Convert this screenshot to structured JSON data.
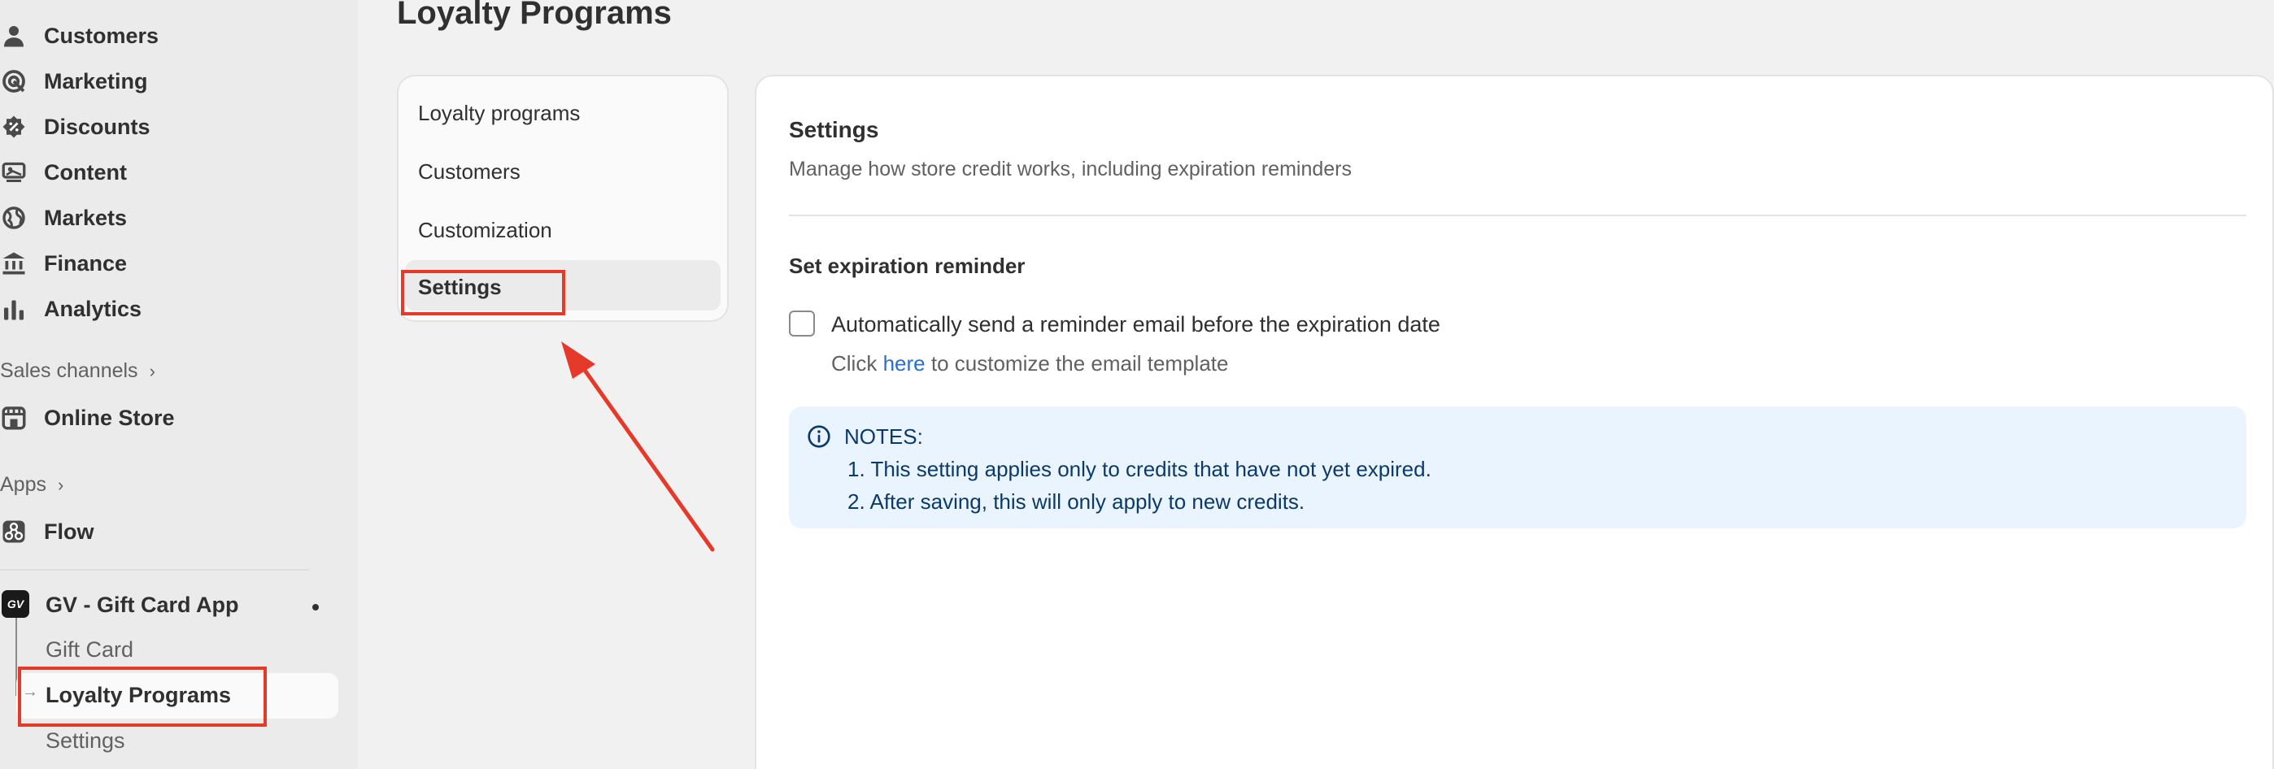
{
  "sidebar": {
    "items": [
      {
        "label": "Customers",
        "icon": "person-icon"
      },
      {
        "label": "Marketing",
        "icon": "target-icon"
      },
      {
        "label": "Discounts",
        "icon": "discount-icon"
      },
      {
        "label": "Content",
        "icon": "content-icon"
      },
      {
        "label": "Markets",
        "icon": "globe-icon"
      },
      {
        "label": "Finance",
        "icon": "bank-icon"
      },
      {
        "label": "Analytics",
        "icon": "bar-chart-icon"
      }
    ],
    "sales_channels_label": "Sales channels",
    "online_store_label": "Online Store",
    "apps_label": "Apps",
    "flow_label": "Flow",
    "app_name": "GV - Gift Card App",
    "app_badge": "GV",
    "app_sub": {
      "gift_card": "Gift Card",
      "loyalty_programs": "Loyalty Programs",
      "settings": "Settings"
    }
  },
  "page": {
    "title": "Loyalty Programs"
  },
  "tabs": {
    "loyalty_programs": "Loyalty programs",
    "customers": "Customers",
    "customization": "Customization",
    "settings": "Settings"
  },
  "settings": {
    "title": "Settings",
    "subtitle": "Manage how store credit works, including expiration reminders",
    "reminder_title": "Set expiration reminder",
    "checkbox_label": "Automatically send a reminder email before the expiration date",
    "checkbox_checked": false,
    "hint_prefix": "Click",
    "hint_link": "here",
    "hint_suffix": "to customize the email template",
    "notes_head": "NOTES:",
    "notes": [
      "1. This setting applies only to credits that have not yet expired.",
      "2. After saving, this will only apply to new credits."
    ]
  },
  "colors": {
    "highlight": "#e53a2a",
    "link": "#2c6ecb",
    "notes_bg": "#eaf4ff"
  }
}
